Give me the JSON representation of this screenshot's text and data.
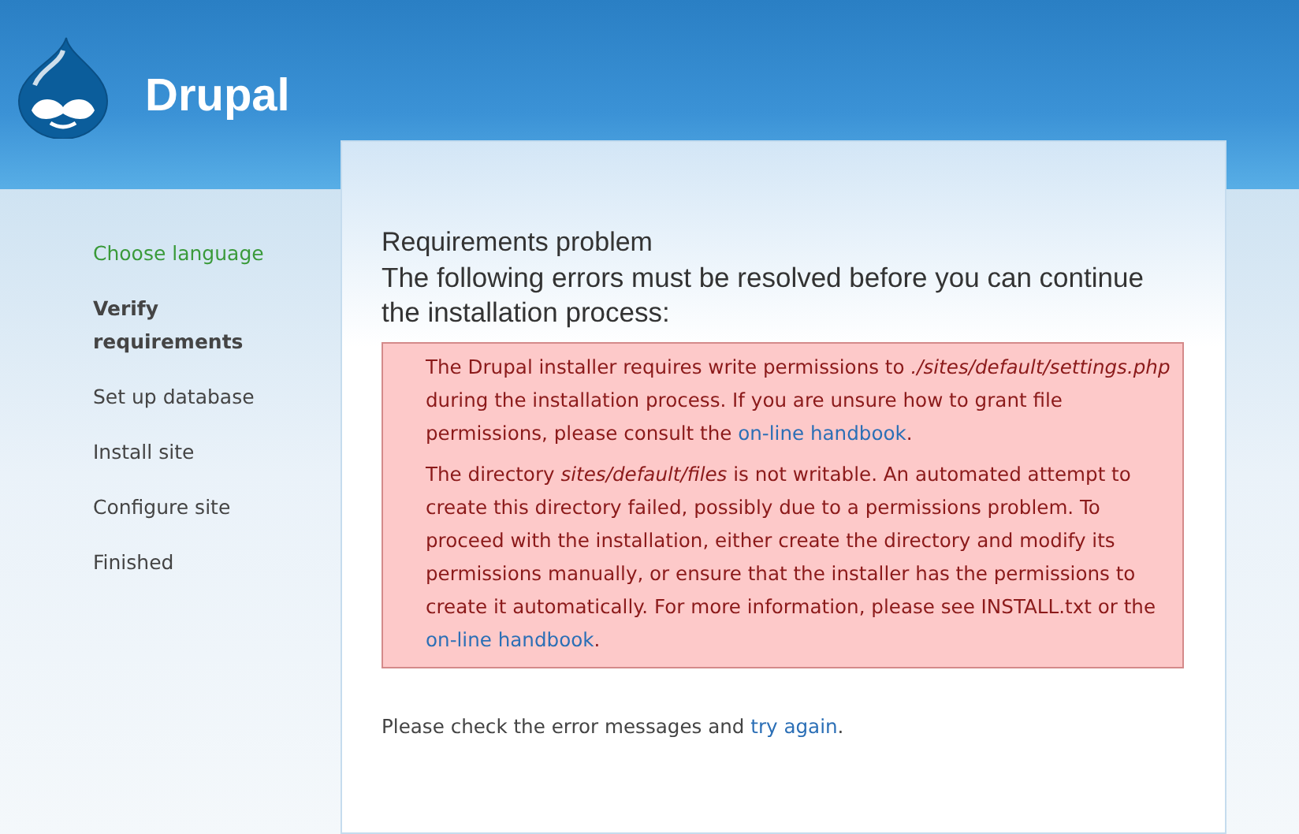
{
  "site_name": "Drupal",
  "steps": [
    {
      "label": "Choose language",
      "kind": "done"
    },
    {
      "label": "Verify requirements",
      "kind": "active"
    },
    {
      "label": "Set up database",
      "kind": "todo"
    },
    {
      "label": "Install site",
      "kind": "todo"
    },
    {
      "label": "Configure site",
      "kind": "todo"
    },
    {
      "label": "Finished",
      "kind": "todo"
    }
  ],
  "title": "Requirements problem",
  "subtitle": "The following errors must be resolved before you can continue the installation process:",
  "errors": [
    [
      {
        "kind": "text",
        "text": "The Drupal installer requires write permissions to "
      },
      {
        "kind": "em",
        "text": "./sites/default/settings.php"
      },
      {
        "kind": "text",
        "text": " during the installation process. If you are unsure how to grant file permissions, please consult the "
      },
      {
        "kind": "link",
        "text": "on-line handbook"
      },
      {
        "kind": "text",
        "text": "."
      }
    ],
    [
      {
        "kind": "text",
        "text": "The directory "
      },
      {
        "kind": "em",
        "text": "sites/default/files"
      },
      {
        "kind": "text",
        "text": " is not writable. An automated attempt to create this directory failed, possibly due to a permissions problem. To proceed with the installation, either create the directory and modify its permissions manually, or ensure that the installer has the permissions to create it automatically. For more information, please see INSTALL.txt or the "
      },
      {
        "kind": "link",
        "text": "on-line handbook"
      },
      {
        "kind": "text",
        "text": "."
      }
    ]
  ],
  "footer": [
    {
      "kind": "text",
      "text": "Please check the error messages and "
    },
    {
      "kind": "link",
      "text": "try again"
    },
    {
      "kind": "text",
      "text": "."
    }
  ]
}
